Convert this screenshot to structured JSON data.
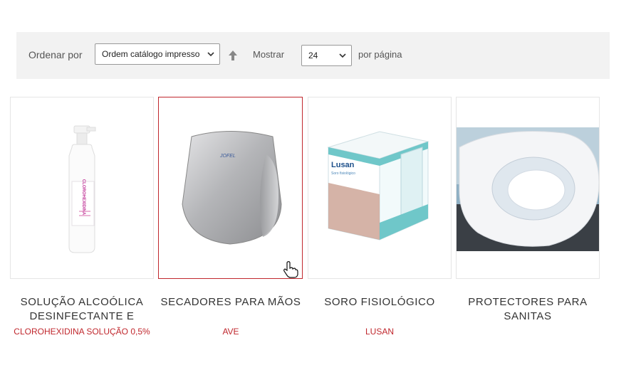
{
  "toolbar": {
    "sort_label": "Ordenar por",
    "sort_value": "Ordem catálogo impresso",
    "show_label": "Mostrar",
    "per_page_value": "24",
    "per_page_suffix": "por página"
  },
  "products": [
    {
      "title": "SOLUÇÃO ALCOÓLICA DESINFECTANTE E",
      "brand": "CLOROHEXIDINA SOLUÇÃO 0,5%",
      "image": "spray-bottle",
      "bottle_label": "CLOROHEXIDINA"
    },
    {
      "title": "SECADORES PARA MÃOS",
      "brand": "AVE",
      "image": "hand-dryer",
      "logo_text": "JOFEL"
    },
    {
      "title": "SORO FISIOLÓGICO",
      "brand": "LUSAN",
      "image": "saline-box",
      "box_brand": "Lusan",
      "box_sub": "Soro fisiológico"
    },
    {
      "title": "PROTECTORES PARA SANITAS",
      "brand": "",
      "image": "toilet-seat-cover"
    }
  ],
  "colors": {
    "accent": "#c0272d",
    "toolbar_bg": "#f2f2f2"
  }
}
